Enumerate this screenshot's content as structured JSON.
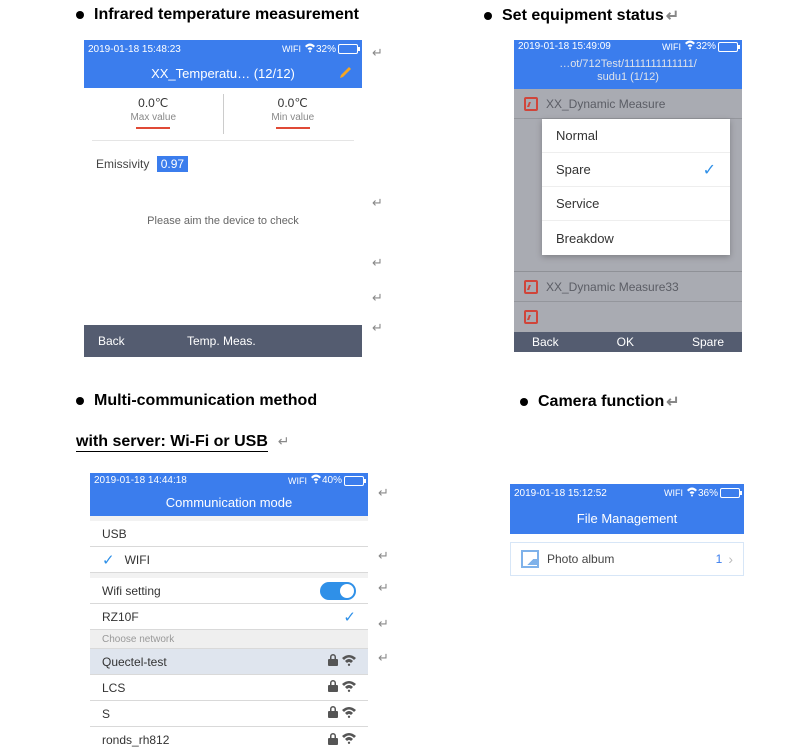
{
  "headings": {
    "h1": "Infrared temperature measurement",
    "h2": "Set equipment status",
    "h3": "Multi-communication method",
    "sub3": "with server: Wi-Fi or USB",
    "h4": "Camera function"
  },
  "screen1": {
    "status": {
      "time": "2019-01-18 15:48:23",
      "wifi_label": "WIFI",
      "battery_pct": "32%"
    },
    "title": "XX_Temperatu…  (12/12)",
    "max": {
      "value": "0.0℃",
      "label": "Max value"
    },
    "min": {
      "value": "0.0℃",
      "label": "Min value"
    },
    "emissivity_label": "Emissivity",
    "emissivity_value": "0.97",
    "hint": "Please aim the device to check",
    "footer": {
      "back": "Back",
      "mid": "Temp. Meas."
    }
  },
  "screen2": {
    "status": {
      "time": "2019-01-18 15:49:09",
      "wifi_label": "WIFI",
      "battery_pct": "32%"
    },
    "breadcrumb_line1": "…ot/712Test/1111111111111/",
    "breadcrumb_line2": "sudu1 (1/12)",
    "row_top": "XX_Dynamic Measure",
    "row_bottom": "XX_Dynamic Measure33",
    "popup": {
      "opt1": "Normal",
      "opt2": "Spare",
      "opt3": "Service",
      "opt4": "Breakdow"
    },
    "footer": {
      "back": "Back",
      "ok": "OK",
      "spare": "Spare"
    }
  },
  "screen3": {
    "status": {
      "time": "2019-01-18 14:44:18",
      "wifi_label": "WIFI",
      "battery_pct": "40%"
    },
    "title": "Communication mode",
    "rows": {
      "usb": "USB",
      "wifi": "WIFI",
      "wifi_setting": "Wifi setting",
      "rz10f": "RZ10F",
      "choose": "Choose network",
      "net1": "Quectel-test",
      "net2": "LCS",
      "net3": "S",
      "net4": "ronds_rh812"
    }
  },
  "screen4": {
    "status": {
      "time": "2019-01-18 15:12:52",
      "wifi_label": "WIFI",
      "battery_pct": "36%"
    },
    "title": "File Management",
    "album_label": "Photo album",
    "album_count": "1"
  },
  "marks": {
    "arrow": "↵",
    "para": "↵"
  }
}
